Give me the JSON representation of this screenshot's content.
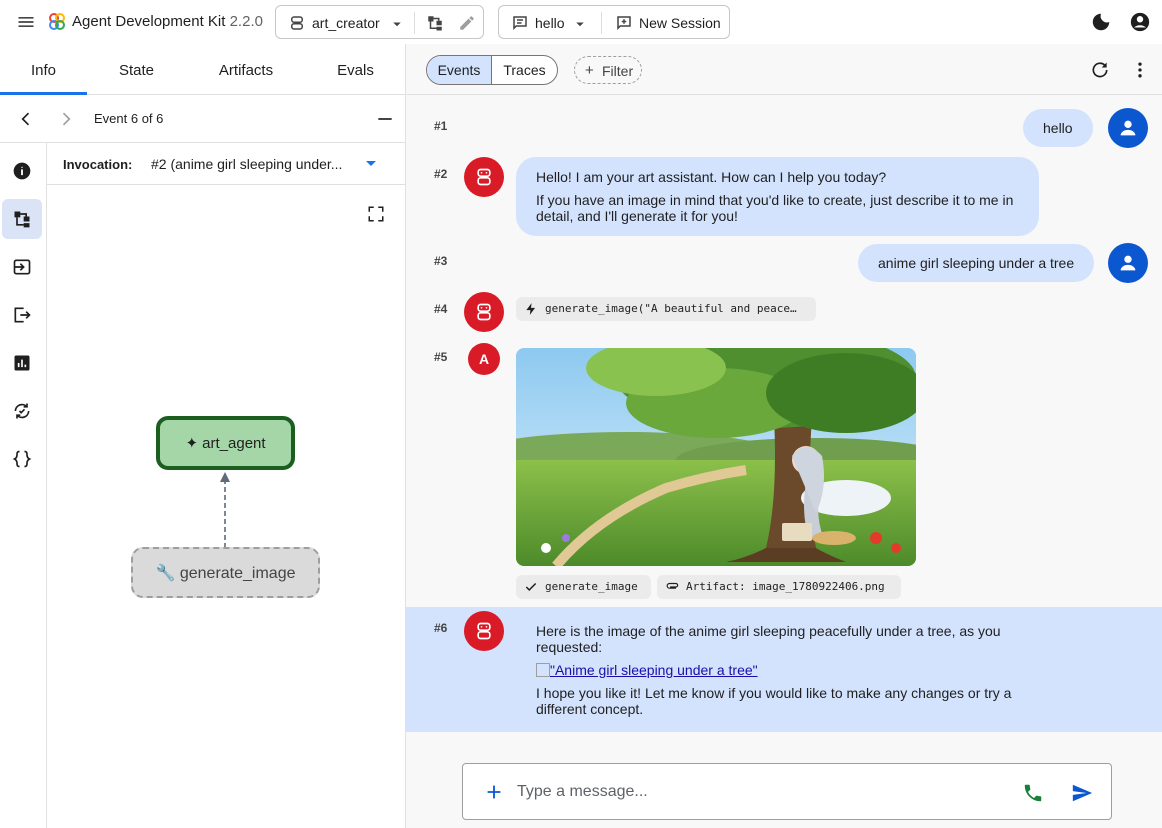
{
  "app": {
    "title": "Agent Development Kit",
    "version": "2.2.0"
  },
  "header": {
    "agent_select": "art_creator",
    "session_select": "hello",
    "new_session_label": "New Session"
  },
  "left_tabs": [
    "Info",
    "State",
    "Artifacts",
    "Evals"
  ],
  "event_nav": {
    "label": "Event 6 of 6"
  },
  "invocation": {
    "label": "Invocation:",
    "value": "#2 (anime girl sleeping under..."
  },
  "graph": {
    "agent_node": "✦ art_agent",
    "tool_node": "🔧 generate_image"
  },
  "right_toolbar": {
    "events_label": "Events",
    "traces_label": "Traces",
    "filter_label": "Filter"
  },
  "events": [
    {
      "num": "#1",
      "role": "user",
      "text": "hello"
    },
    {
      "num": "#2",
      "role": "bot",
      "lines": [
        "Hello! I am your art assistant. How can I help you today?",
        "If you have an image in mind that you'd like to create, just describe it to me in",
        "detail, and I'll generate it for you!"
      ]
    },
    {
      "num": "#3",
      "role": "user",
      "text": "anime girl sleeping under a tree"
    },
    {
      "num": "#4",
      "role": "bot",
      "chip": "generate_image(\"A beautiful and peace…"
    },
    {
      "num": "#5",
      "role": "artifact",
      "avatar_letter": "A",
      "chip_tool": "generate_image",
      "chip_artifact": "Artifact: image_1780922406.png"
    },
    {
      "num": "#6",
      "role": "bot",
      "line1": "Here is the image of the anime girl sleeping peacefully under a tree, as you",
      "line2": "requested:",
      "link": "\"Anime girl sleeping under a tree\"",
      "line3": "I hope you like it! Let me know if you would like to make any changes or try a",
      "line4": "different concept."
    }
  ],
  "composer": {
    "placeholder": "Type a message..."
  },
  "colors": {
    "accent": "#0b57d0",
    "bubble": "#d3e3fd",
    "bot_avatar": "#d81b27",
    "agent_node": "#a5d6a7",
    "agent_border": "#1b5e20"
  },
  "icons": [
    "menu-icon",
    "adk-logo-icon",
    "agent-icon",
    "graph-icon",
    "edit-icon",
    "chat-icon",
    "chevron-down-icon",
    "add-comment-icon",
    "dark-mode-icon",
    "account-icon",
    "chevron-left-icon",
    "chevron-right-icon",
    "minimize-icon",
    "info-icon",
    "event-graph-icon",
    "request-icon",
    "response-icon",
    "metrics-icon",
    "sync-icon",
    "code-braces-icon",
    "fullscreen-icon",
    "refresh-icon",
    "more-vert-icon",
    "person-icon",
    "robot-icon",
    "bolt-icon",
    "check-icon",
    "attachment-icon",
    "plus-icon",
    "phone-icon",
    "send-icon"
  ]
}
